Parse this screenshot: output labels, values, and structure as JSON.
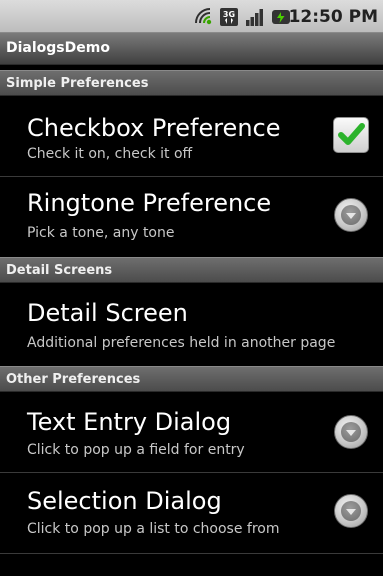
{
  "status": {
    "time": "12:50 PM",
    "icons": [
      "wifi-icon",
      "3g-icon",
      "signal-icon",
      "battery-icon"
    ]
  },
  "app_title": "DialogsDemo",
  "sections": [
    {
      "header": "Simple Preferences"
    },
    {
      "header": "Detail Screens"
    },
    {
      "header": "Other Preferences"
    }
  ],
  "prefs": {
    "checkbox": {
      "title": "Checkbox Preference",
      "summary": "Check it on, check it off",
      "checked": true
    },
    "ringtone": {
      "title": "Ringtone Preference",
      "summary": "Pick a tone, any tone"
    },
    "detail": {
      "title": "Detail Screen",
      "summary": "Additional preferences held in another page"
    },
    "text_entry": {
      "title": "Text Entry Dialog",
      "summary": "Click to pop up a field for entry"
    },
    "selection": {
      "title": "Selection Dialog",
      "summary": "Click to pop up a list to choose from"
    }
  },
  "colors": {
    "check": "#2cb32c",
    "background": "#000000",
    "header": "#5a5a5a"
  }
}
